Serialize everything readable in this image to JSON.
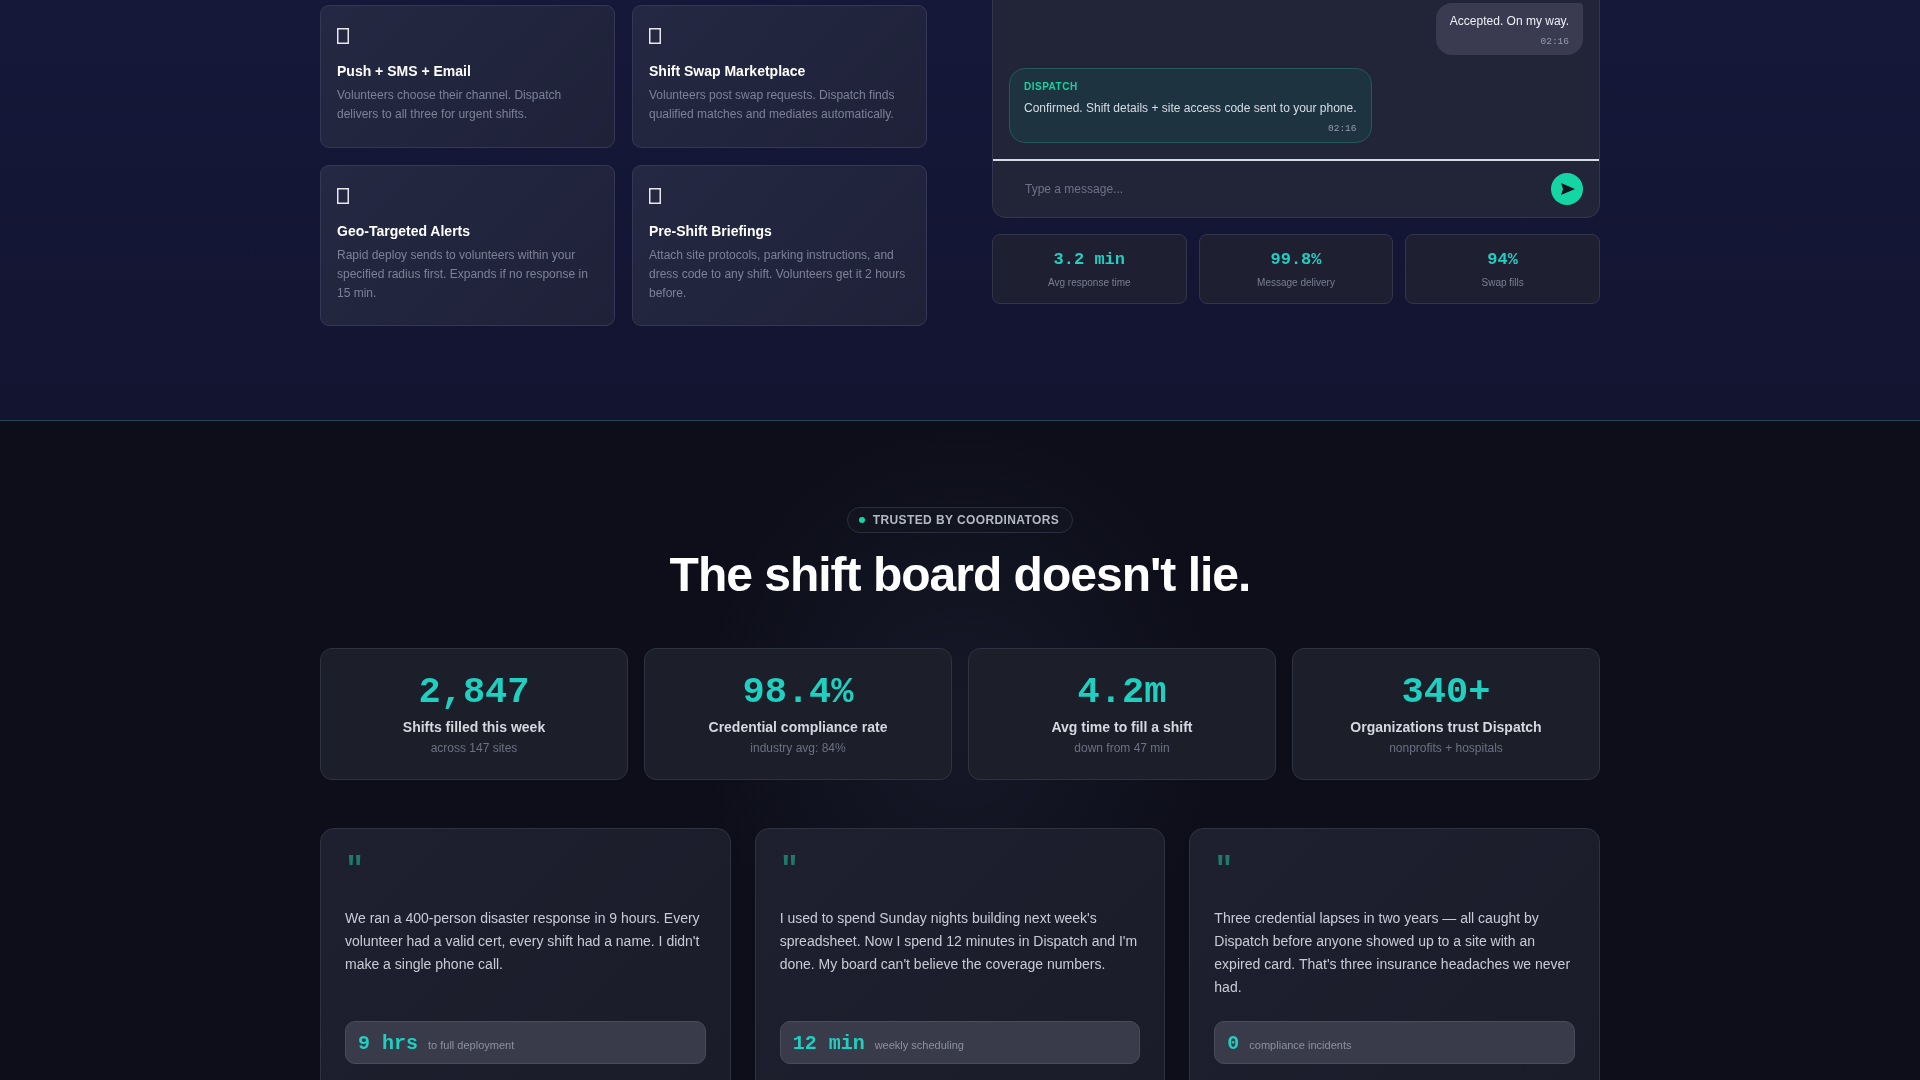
{
  "features": [
    {
      "title": "Push + SMS + Email",
      "description": "Volunteers choose their channel. Dispatch delivers to all three for urgent shifts."
    },
    {
      "title": "Shift Swap Marketplace",
      "description": "Volunteers post swap requests. Dispatch finds qualified matches and mediates automatically."
    },
    {
      "title": "Geo-Targeted Alerts",
      "description": "Rapid deploy sends to volunteers within your specified radius first. Expands if no response in 15 min."
    },
    {
      "title": "Pre-Shift Briefings",
      "description": "Attach site protocols, parking instructions, and dress code to any shift. Volunteers get it 2 hours before."
    }
  ],
  "chat": {
    "messages": [
      {
        "kind": "sent",
        "text": "Accepted. On my way.",
        "time": "02:16"
      },
      {
        "kind": "received",
        "sender": "DISPATCH",
        "text": "Confirmed. Shift details + site access code sent to your phone.",
        "time": "02:16"
      }
    ],
    "input": {
      "placeholder": "Type a message..."
    }
  },
  "chat_stats": [
    {
      "value": "3.2 min",
      "label": "Avg response time"
    },
    {
      "value": "99.8%",
      "label": "Message delivery"
    },
    {
      "value": "94%",
      "label": "Swap fills"
    }
  ],
  "trust": {
    "badge": "TRUSTED BY COORDINATORS",
    "headline": "The shift board doesn't lie."
  },
  "stats": [
    {
      "value": "2,847",
      "label": "Shifts filled this week",
      "note": "across 147 sites"
    },
    {
      "value": "98.4%",
      "label": "Credential compliance rate",
      "note": "industry avg: 84%"
    },
    {
      "value": "4.2m",
      "label": "Avg time to fill a shift",
      "note": "down from 47 min"
    },
    {
      "value": "340+",
      "label": "Organizations trust Dispatch",
      "note": "nonprofits + hospitals"
    }
  ],
  "testimonials": [
    {
      "mark": "\"",
      "quote": "We ran a 400-person disaster response in 9 hours. Every volunteer had a valid cert, every shift had a name. I didn't make a single phone call.",
      "metric": "9 hrs",
      "metric_label": "to full deployment"
    },
    {
      "mark": "\"",
      "quote": "I used to spend Sunday nights building next week's spreadsheet. Now I spend 12 minutes in Dispatch and I'm done. My board can't believe the coverage numbers.",
      "metric": "12 min",
      "metric_label": "weekly scheduling"
    },
    {
      "mark": "\"",
      "quote": "Three credential lapses in two years — all caught by Dispatch before anyone showed up to a site with an expired card. That's three insurance headaches we never had.",
      "metric": "0",
      "metric_label": "compliance incidents"
    }
  ]
}
